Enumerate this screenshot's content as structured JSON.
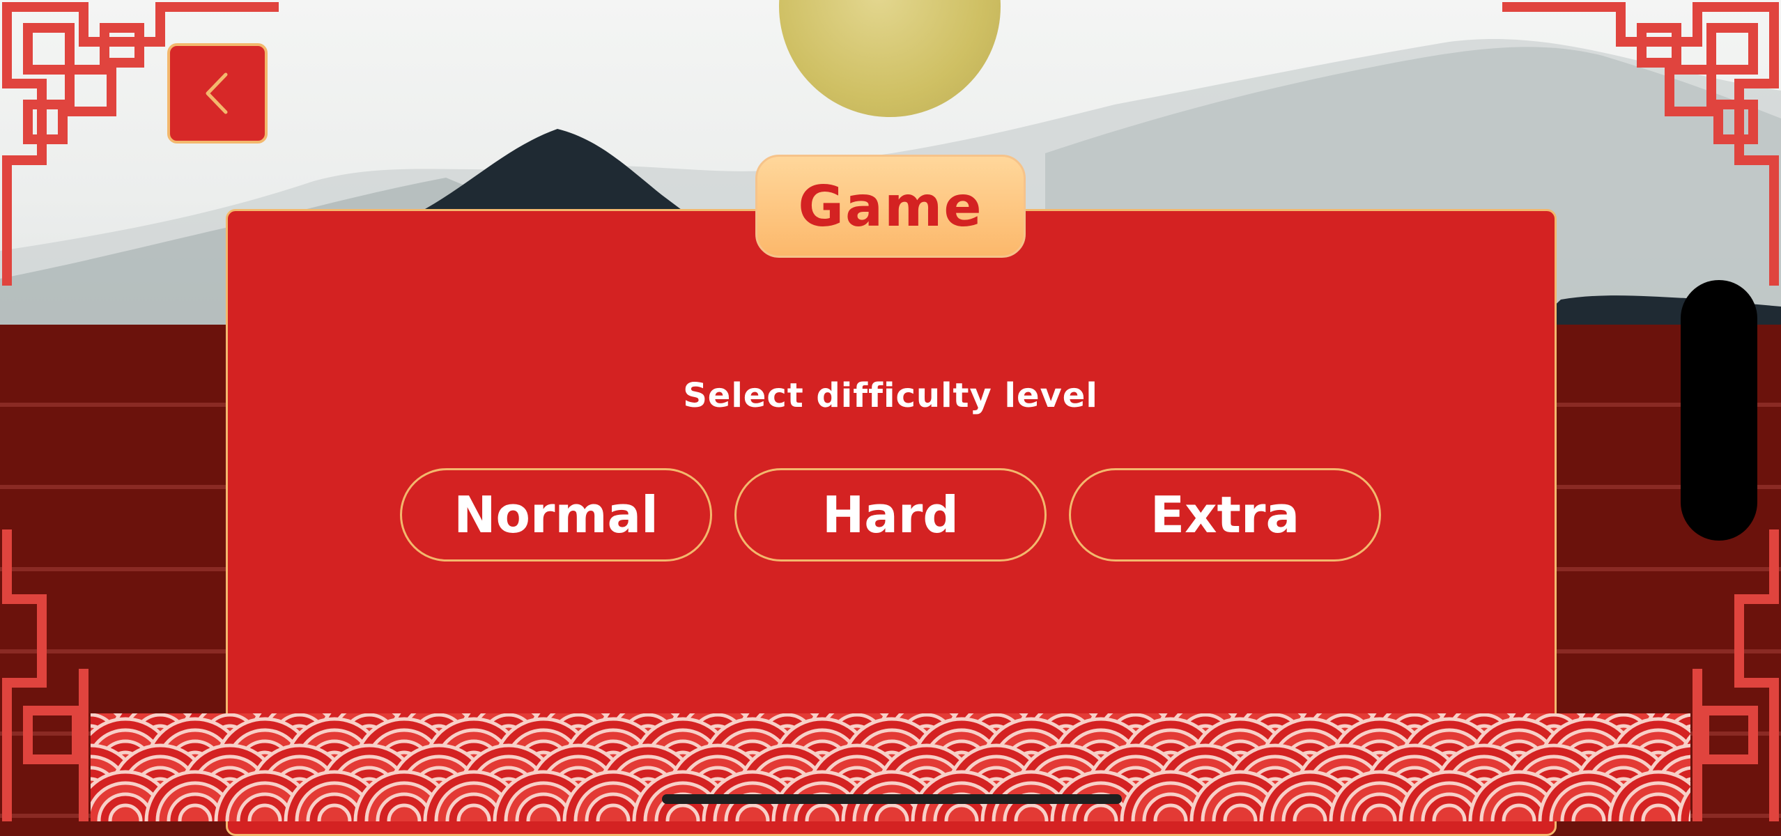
{
  "title": "Game",
  "subtitle": "Select difficulty level",
  "difficulty_options": [
    {
      "label": "Normal"
    },
    {
      "label": "Hard"
    },
    {
      "label": "Extra"
    }
  ],
  "icons": {
    "back": "chevron-left-icon"
  },
  "colors": {
    "panel": "#d42222",
    "accent_gold": "#f3b86d",
    "tab_gradient_top": "#ffd79b",
    "tab_gradient_bottom": "#fcb86b",
    "wall": "#6b120c",
    "text": "#ffffff"
  }
}
